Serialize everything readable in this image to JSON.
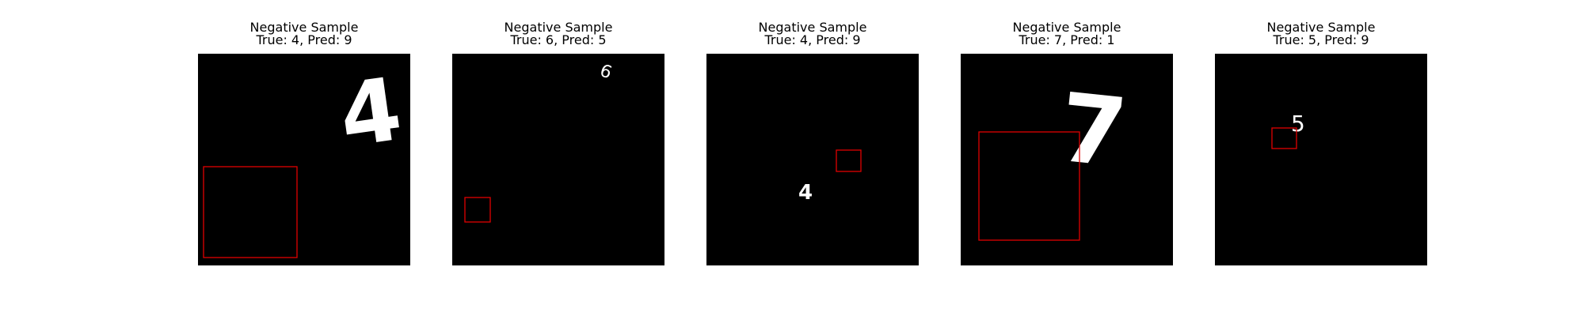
{
  "panels": [
    {
      "title": "Negative Sample",
      "subtitle": "True: 4, Pred: 9",
      "digit": "4"
    },
    {
      "title": "Negative Sample",
      "subtitle": "True: 6, Pred: 5",
      "digit": "6"
    },
    {
      "title": "Negative Sample",
      "subtitle": "True: 4, Pred: 9",
      "digit": "4"
    },
    {
      "title": "Negative Sample",
      "subtitle": "True: 7, Pred: 1",
      "digit": "7"
    },
    {
      "title": "Negative Sample",
      "subtitle": "True: 5, Pred: 9",
      "digit": "5"
    }
  ],
  "colors": {
    "background": "#000000",
    "digit": "#ffffff",
    "box": "#e00000"
  }
}
